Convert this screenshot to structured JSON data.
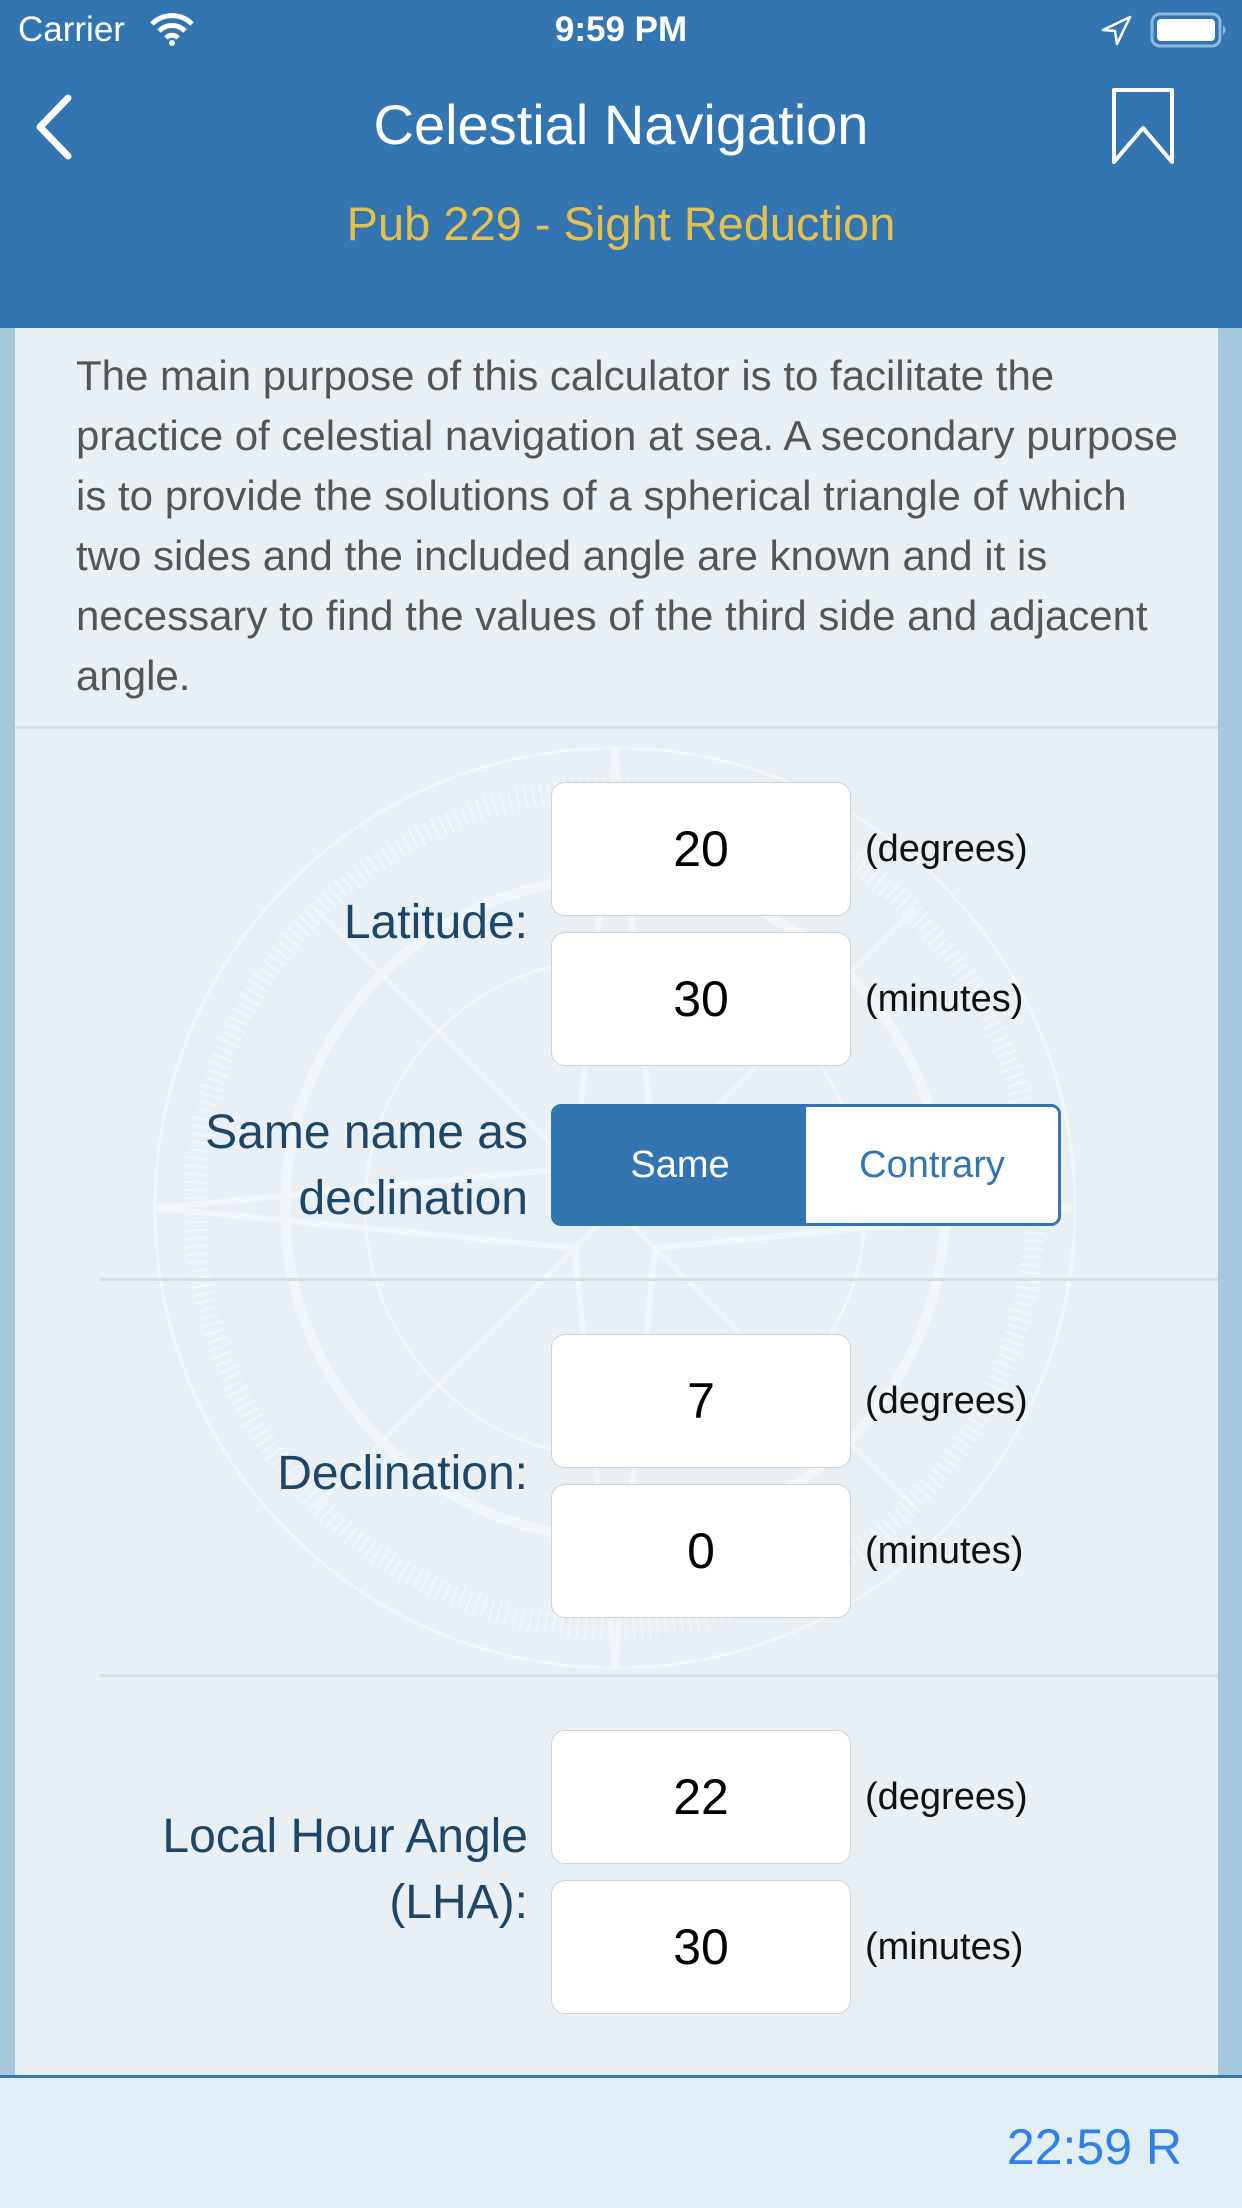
{
  "status_bar": {
    "carrier": "Carrier",
    "time": "9:59 PM",
    "icons": [
      "wifi-icon",
      "location-icon",
      "battery-icon"
    ]
  },
  "nav": {
    "title": "Celestial Navigation",
    "subtitle": "Pub 229 - Sight Reduction",
    "back_icon": "chevron-left-icon",
    "bookmark_icon": "bookmark-icon"
  },
  "intro_text": "The main purpose of this calculator is to facilitate the practice of celestial navigation at sea.  A secondary purpose is to provide the solutions of a spherical triangle of which two sides and the included angle are known and it is necessary to find the values of the third side and adjacent angle.",
  "latitude": {
    "label": "Latitude:",
    "degrees": "20",
    "minutes": "30",
    "degrees_unit": "(degrees)",
    "minutes_unit": "(minutes)"
  },
  "same_name": {
    "label_line1": "Same name as",
    "label_line2": "declination",
    "options": [
      "Same",
      "Contrary"
    ],
    "selected": "Same"
  },
  "declination": {
    "label": "Declination:",
    "degrees": "7",
    "minutes": "0",
    "degrees_unit": "(degrees)",
    "minutes_unit": "(minutes)"
  },
  "lha": {
    "label_line1": "Local Hour Angle",
    "label_line2": "(LHA):",
    "degrees": "22",
    "minutes": "30",
    "degrees_unit": "(degrees)",
    "minutes_unit": "(minutes)"
  },
  "footer": {
    "result": "22:59 R"
  },
  "colors": {
    "primary": "#3275b0",
    "subtitle": "#e3c04f",
    "label": "#1e4669",
    "footer_text": "#2f80e8"
  }
}
